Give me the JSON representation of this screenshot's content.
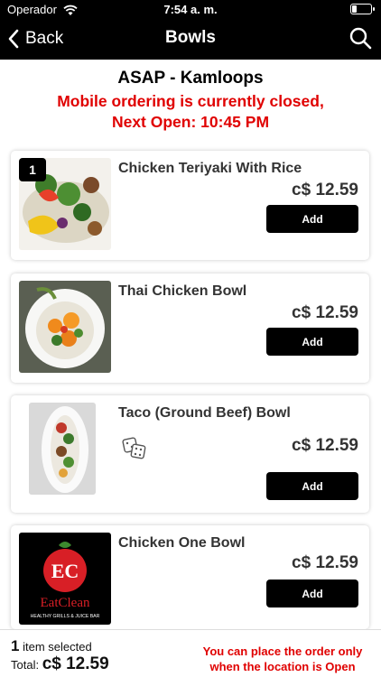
{
  "status_bar": {
    "carrier": "Operador",
    "time": "7:54 a. m."
  },
  "nav": {
    "back_label": "Back",
    "title": "Bowls"
  },
  "location": {
    "name": "ASAP - Kamloops",
    "closed_line1": "Mobile ordering is currently closed,",
    "closed_line2": "Next Open: 10:45 PM"
  },
  "items": [
    {
      "name": "Chicken Teriyaki With Rice",
      "price": "c$ 12.59",
      "add_label": "Add",
      "qty": "1"
    },
    {
      "name": "Thai Chicken Bowl",
      "price": "c$ 12.59",
      "add_label": "Add"
    },
    {
      "name": "Taco (Ground Beef) Bowl",
      "price": "c$ 12.59",
      "add_label": "Add"
    },
    {
      "name": "Chicken One Bowl",
      "price": "c$ 12.59",
      "add_label": "Add"
    }
  ],
  "logo": {
    "initials": "EC",
    "brand": "EatClean",
    "tagline": "HEALTHY GRILLS & JUICE BAR"
  },
  "footer": {
    "selected_count": "1",
    "selected_text": "item selected",
    "total_label": "Total:",
    "total_value": "c$ 12.59",
    "warning_line1": "You can place the order only",
    "warning_line2": "when the location is Open"
  },
  "colors": {
    "accent_red": "#e00000",
    "bar_black": "#000000"
  }
}
